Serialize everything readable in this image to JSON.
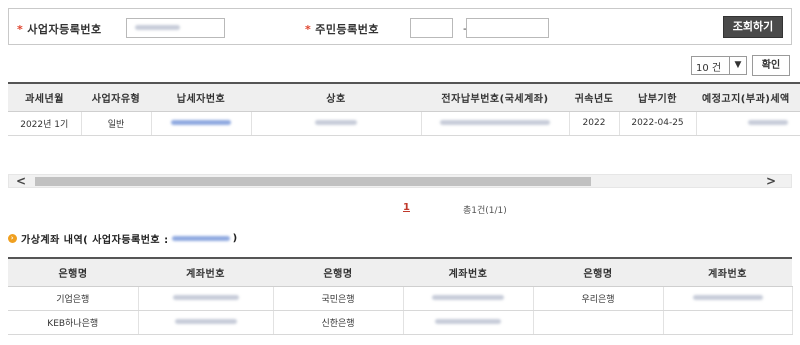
{
  "search": {
    "biz_reg_label": "사업자등록번호",
    "biz_reg_value": "",
    "resident_label": "주민등록번호",
    "resident_front": "",
    "resident_dash": "-",
    "resident_back": "",
    "search_button": "조회하기",
    "required_mark": "*"
  },
  "list_controls": {
    "page_size": "10 건",
    "confirm_button": "확인"
  },
  "tax_table": {
    "headers": [
      "과세년월",
      "사업자유형",
      "납세자번호",
      "상호",
      "전자납부번호(국세계좌)",
      "귀속년도",
      "납부기한",
      "예정고지(부과)세액"
    ],
    "rows": [
      [
        "2022년 1기",
        "일반",
        "",
        "",
        "",
        "2022",
        "2022-04-25",
        ""
      ]
    ]
  },
  "pagination": {
    "current_page": "1",
    "total": "총1건(1/1)"
  },
  "virtual_account": {
    "title_prefix": "가상계좌 내역( 사업자등록번호 :",
    "title_value": "",
    "title_suffix": ")",
    "headers": [
      "은행명",
      "계좌번호",
      "은행명",
      "계좌번호",
      "은행명",
      "계좌번호"
    ],
    "rows": [
      [
        "기업은행",
        "",
        "국민은행",
        "",
        "우리은행",
        ""
      ],
      [
        "KEB하나은행",
        "",
        "신한은행",
        "",
        "",
        ""
      ]
    ]
  },
  "colors": {
    "required": "#e0442e",
    "blurred_link": "#6a8fd8",
    "page_link": "#c0392b",
    "bullet": "#f0a020"
  }
}
